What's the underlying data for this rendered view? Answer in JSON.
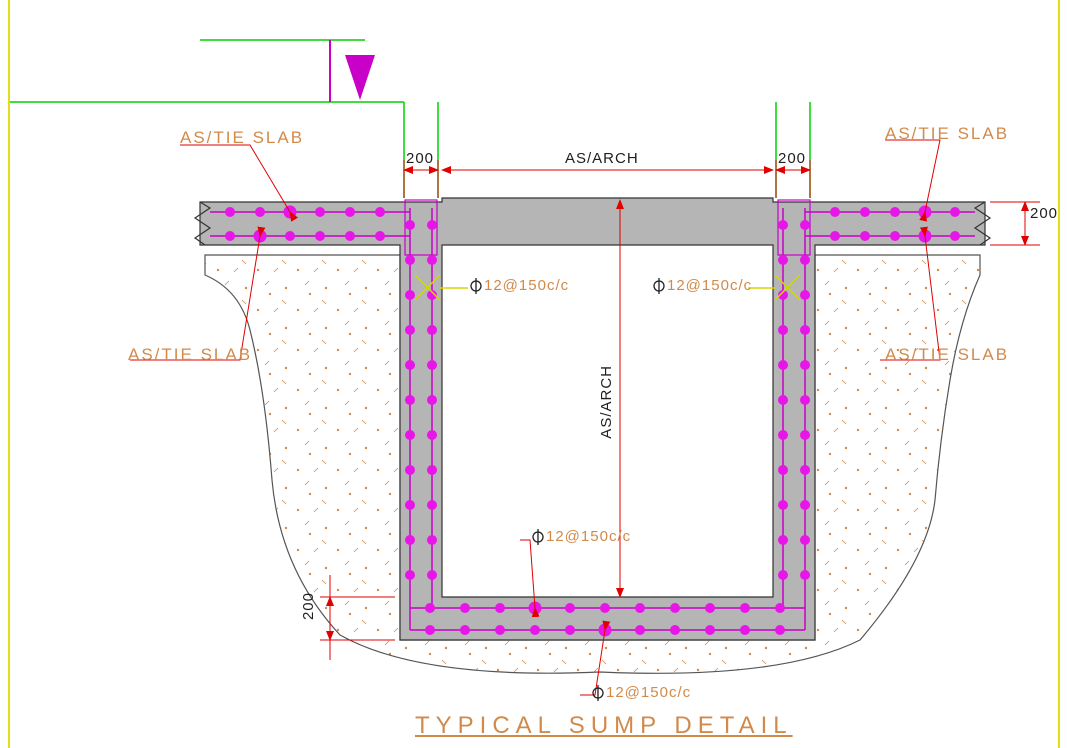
{
  "title": "TYPICAL  SUMP  DETAIL",
  "dimensions": {
    "wall_left": "200",
    "wall_right": "200",
    "slab_right": "200",
    "base": "200",
    "clear_width": "AS/ARCH",
    "clear_depth": "AS/ARCH"
  },
  "rebar": {
    "wall_left": "12@150c/c",
    "wall_right": "12@150c/c",
    "base_top": "12@150c/c",
    "base_bottom": "12@150c/c"
  },
  "labels": {
    "tie_top_left": "AS/TIE SLAB",
    "tie_bot_left": "AS/TIE SLAB",
    "tie_top_right": "AS/TIE SLAB",
    "tie_bot_right": "AS/TIE SLAB"
  },
  "colors": {
    "concrete": "#b5b5b5",
    "rebar_dot": "#e815e8",
    "rebar_line": "#c800c8",
    "leader": "#e00000",
    "text_eng": "#d18a4a",
    "datum": "#00d000",
    "tag": "#d6d600"
  }
}
